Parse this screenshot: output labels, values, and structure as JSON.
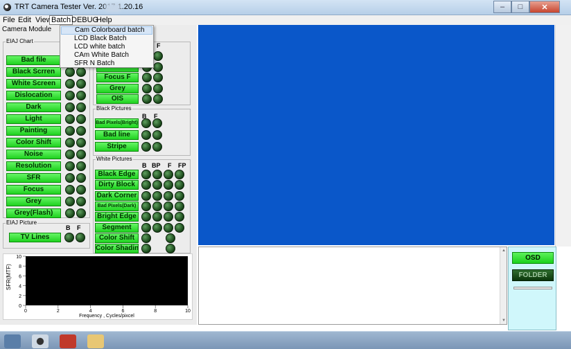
{
  "window": {
    "title": "TRT  Camera Tester  Ver. 2017.1.20.16"
  },
  "menu": [
    {
      "label": "File"
    },
    {
      "label": "Edit"
    },
    {
      "label": "View"
    },
    {
      "label": "Batch"
    },
    {
      "label": "DEBUG"
    },
    {
      "label": "Help"
    }
  ],
  "batch_menu": [
    "Cam Colorboard batch",
    "LCD Black Batch",
    "LCD white batch",
    "CAm White Batch",
    "SFR N  Batch"
  ],
  "left": {
    "panel_label": "Camera Module",
    "eiaj_chart": {
      "title": "EIAJ Chart",
      "buttons": [
        "Bad file",
        "Black Scrren",
        "White Screen",
        "Dislocation",
        "Dark",
        "Light",
        "Painting",
        "Color Shift",
        "Noise",
        "Resolution",
        "SFR",
        "Focus",
        "Grey",
        "Grey(Flash)"
      ]
    },
    "upper_right": {
      "header_f": "F",
      "buttons": [
        "",
        "",
        "Focus F",
        "Grey",
        "OIS"
      ]
    },
    "black_pictures": {
      "title": "Black Pictures",
      "headers": [
        "B",
        "F"
      ],
      "buttons": [
        "Bad Pixels(Bright)",
        "Bad line",
        "Stripe"
      ]
    },
    "white_pictures": {
      "title": "White Pictures",
      "headers": [
        "B",
        "BP",
        "F",
        "FP"
      ],
      "buttons": [
        "Black Edge",
        "Dirty Block",
        "Dark Corner",
        "Bad Pixels(Dark)",
        "Bright Edge",
        "Segment",
        "Color Shift",
        "Color Shading"
      ]
    },
    "eiaj_picture": {
      "title": "EIAJ Picture",
      "headers": [
        "B",
        "F"
      ],
      "button": "TV Lines"
    },
    "chart": {
      "ylabel": "SFR(MTF)",
      "xlabel": "Frequency , Cycles/pixcel"
    }
  },
  "chart_data": {
    "type": "line",
    "series": [],
    "xlabel": "Frequency , Cycles/pixcel",
    "ylabel": "SFR(MTF)",
    "xlim": [
      0,
      10
    ],
    "ylim": [
      0,
      10
    ],
    "xticks": [
      0,
      2,
      4,
      6,
      8,
      10
    ],
    "yticks": [
      0,
      2,
      4,
      6,
      8,
      10
    ],
    "background": "#000000"
  },
  "right_panel": {
    "osd_label": "OSD",
    "folder_label": "FOLDER"
  },
  "colors": {
    "preview_blue": "#0a57c9",
    "button_green": "#1fd21f",
    "side_panel": "#d0f7fb"
  }
}
